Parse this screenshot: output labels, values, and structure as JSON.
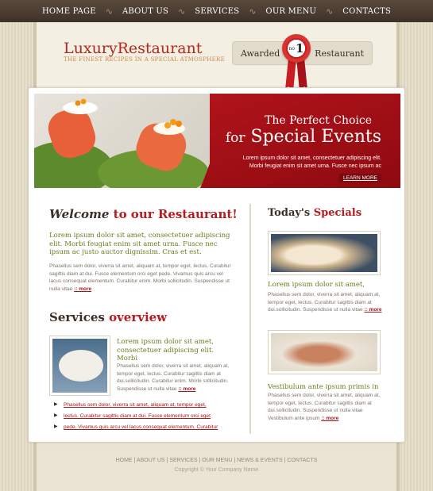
{
  "nav": {
    "items": [
      "HOME PAGE",
      "ABOUT US",
      "SERVICES",
      "OUR MENU",
      "CONTACTS"
    ]
  },
  "header": {
    "logo_part1": "Luxury",
    "logo_part2": "Restaurant",
    "tagline": "THE FINEST RECIPES IN A SPECIAL ATMOSPHERE",
    "award_left": "Awarded",
    "award_right": "Restaurant",
    "award_no": "no",
    "award_num": "1"
  },
  "banner": {
    "line1": "The Perfect Choice",
    "line2_for": "for",
    "line2_main": "Special Events",
    "text": "Lorem ipsum dolor sit amet, consectetuer adipiscing elit. Morbi feugiat enim sit amet urna. Fusce nec ipsum ac",
    "learn_more": "LEARN MORE"
  },
  "welcome": {
    "heading_a": "Welcome",
    "heading_b": "to our Restaurant!",
    "lead": "Lorem ipsum dolor sit amet, consectetuer adipiscing elit. Morbi feugiat enim sit amet urna. Fusce nec ipsum ac justo auctor dignissim. Cras et est.",
    "body": "Phasellus sem dolor, viverra sit amet, aliquam at, tempor eget, lectus. Curabitur sagittis diam at dui. Fusce elementum orci eget pede. Vivamus quis arcu vel lacus consequat elementum. Curabitur enim. Morbi sollicitudin. Suspendisse ut nulla vitae",
    "more": ":: more"
  },
  "services": {
    "heading_a": "Services",
    "heading_b": "overview",
    "lead": "Lorem ipsum dolor sit amet, consectetuer adipiscing elit. Morbi",
    "body": "Phasellus sem dolor, viverra sit amet, aliquam at, tempor eget, lectus. Curabitur sagittis diam at dui.sollicitudin. Curabitur enim. Morbi sollicitudin. Suspendisse ut nulla vitae",
    "more": ":: more",
    "list": [
      "Phasellus sem dolor, viverra sit amet, aliquam at, tempor eget,",
      "lectus. Curabitur sagittis diam at dui. Fusce elementum orci eget",
      "pede. Vivamus quis arcu vel lacus consequat elementum. Curabitur"
    ]
  },
  "specials": {
    "heading_a": "Today's",
    "heading_b": "Specials",
    "items": [
      {
        "title": "Lorem ipsum dolor sit amet,",
        "body": "Phasellus sem dolor, viverra sit amet, aliquam at, tempor eget, lectus. Curabitur sagittis diam at dui.sollicitudin. Suspendisse ut nulla vitae",
        "more": ":: more"
      },
      {
        "title": "Vestibulum ante ipsum primis in",
        "body": "Phasellus sem dolor, viverra sit amet, aliquam at, tempor eget, lectus. Curabitur sagittis diam at dui.sollicitudin. Suspendisse ut nulla vitae Vestibulum ante ipsum",
        "more": ":: more"
      }
    ]
  },
  "footer": {
    "links": [
      "HOME",
      "ABOUT US",
      "SERVICES",
      "OUR MENU",
      "NEWS & EVENTS",
      "CONTACTS"
    ],
    "copyright": "Copyright © Your Company Name"
  }
}
